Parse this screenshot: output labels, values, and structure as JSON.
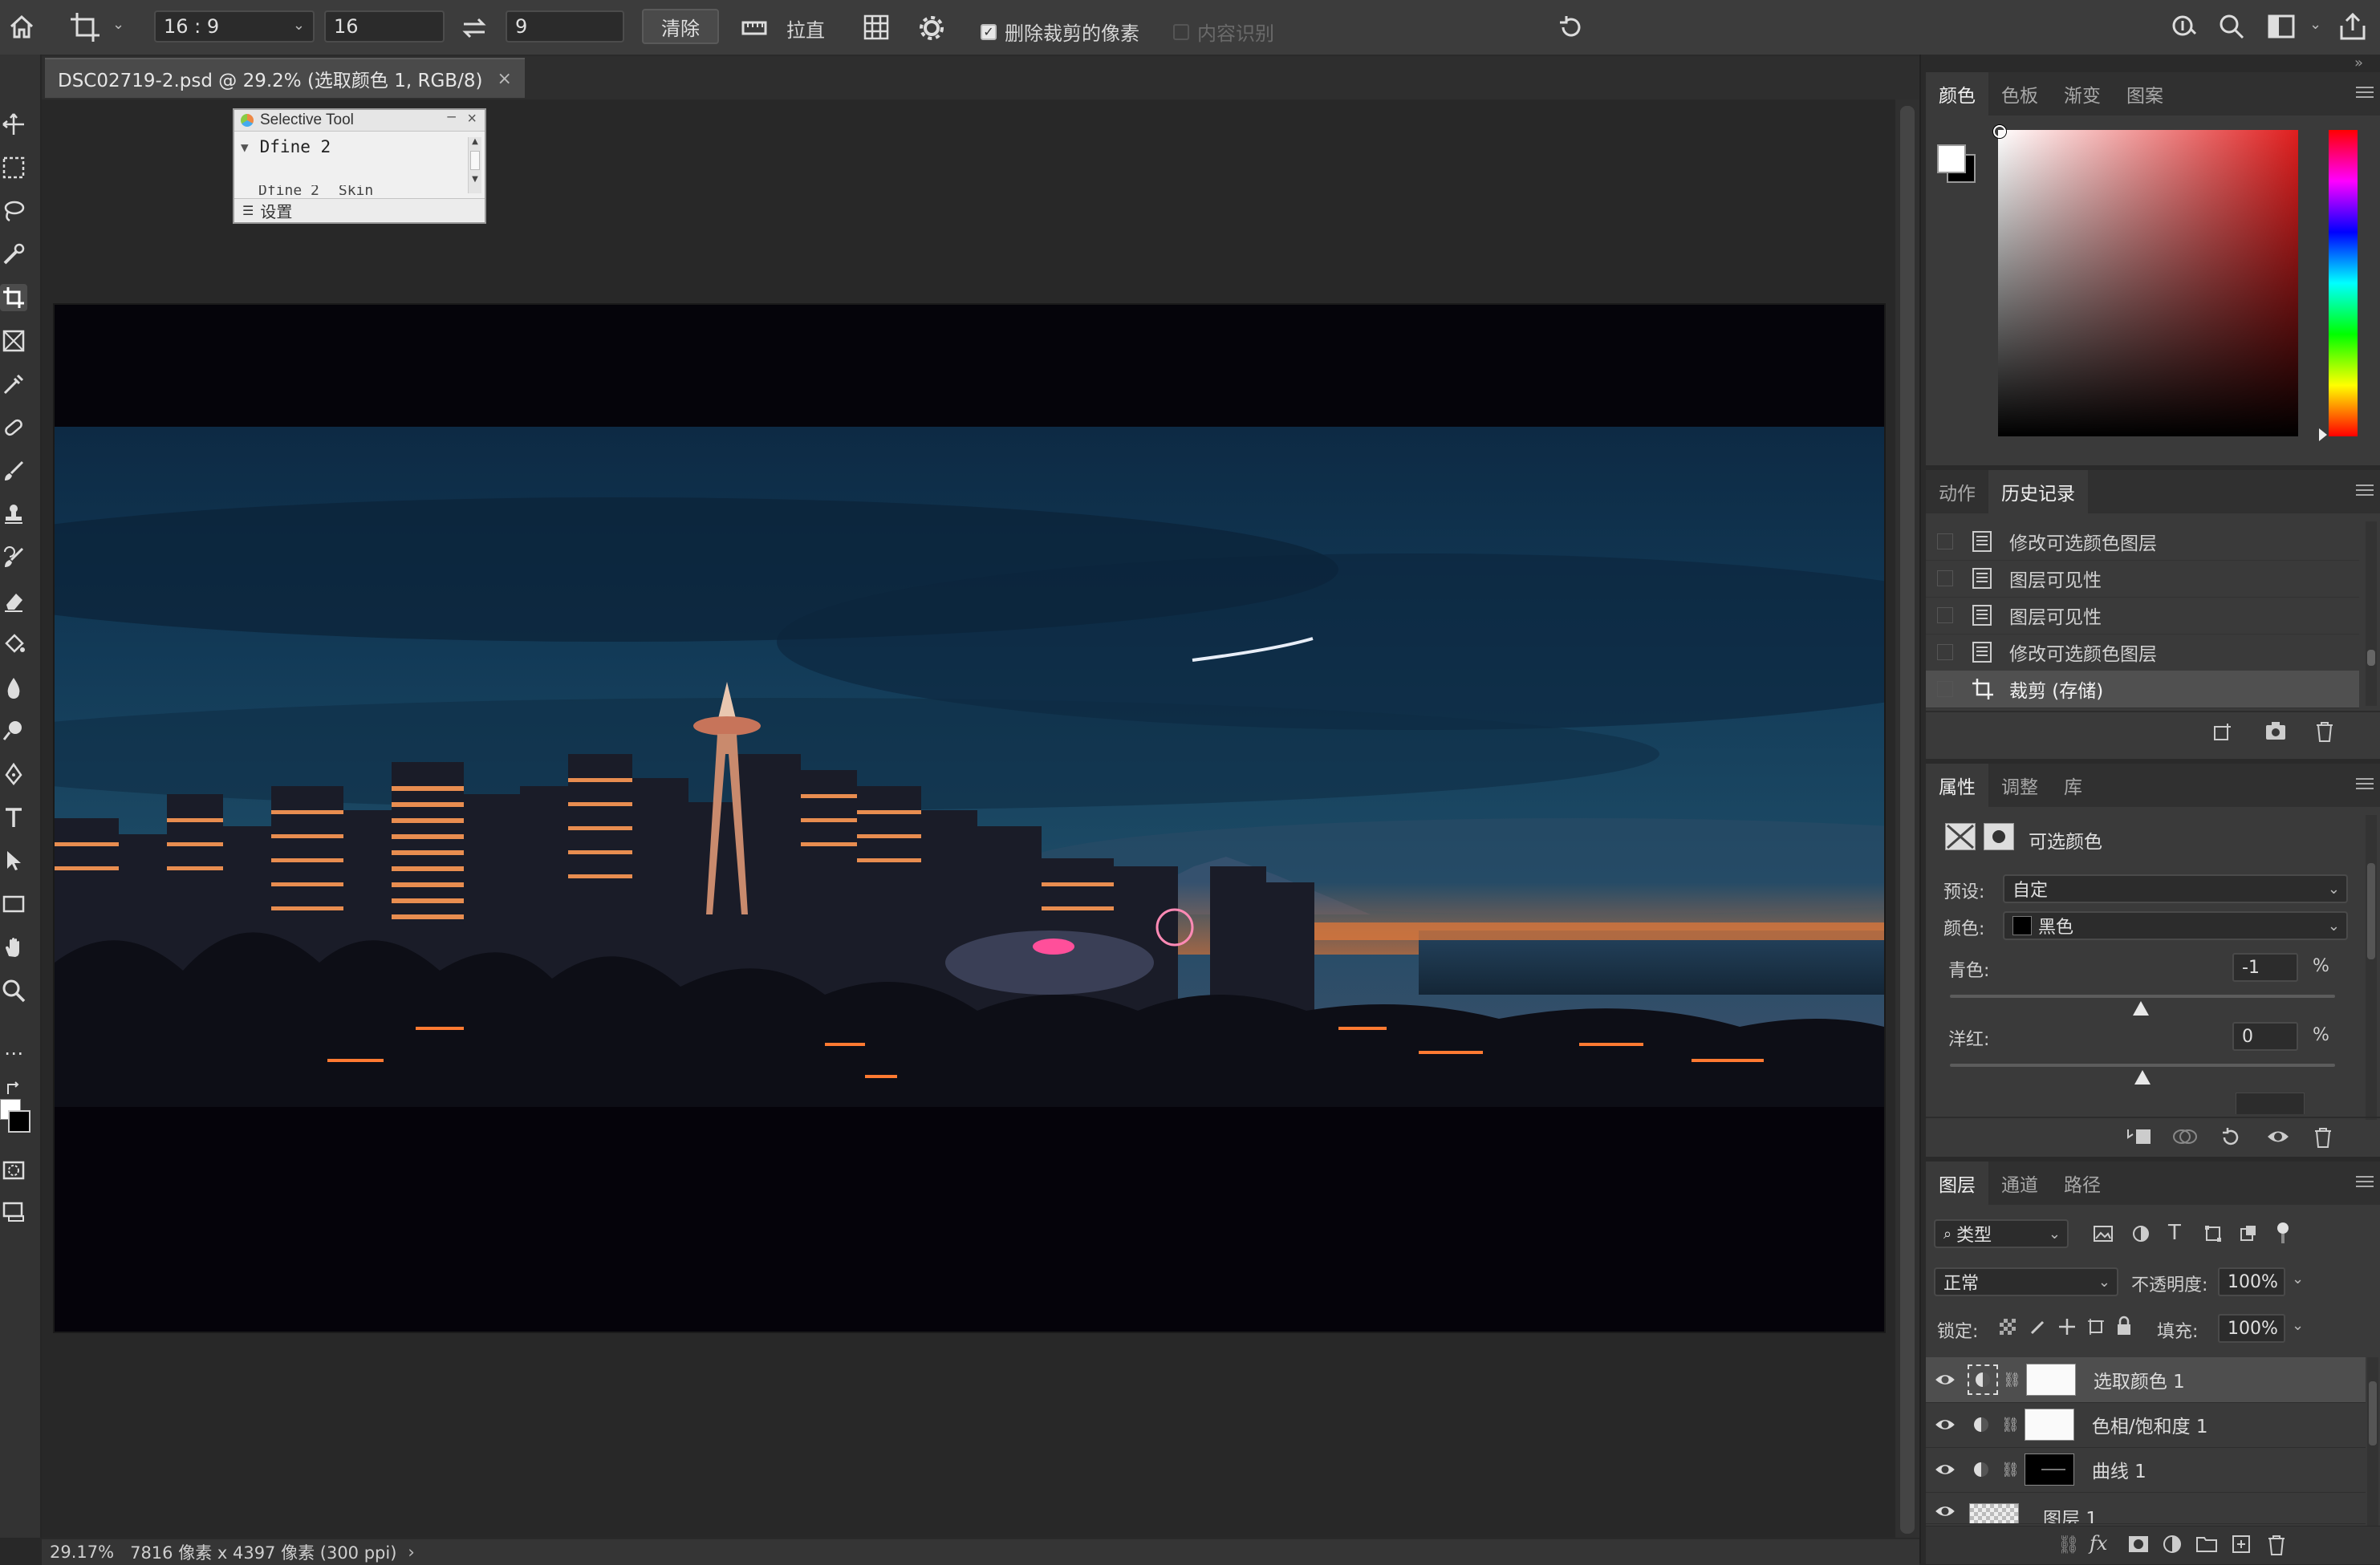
{
  "options_bar": {
    "ratio_preset": "16 : 9",
    "width_value": "16",
    "height_value": "9",
    "clear_label": "清除",
    "straighten_label": "拉直",
    "delete_cropped_label": "删除裁剪的像素",
    "content_aware_label": "内容识别"
  },
  "document": {
    "tab_title": "DSC02719-2.psd @ 29.2% (选取颜色 1, RGB/8)",
    "zoom": "29.17%",
    "dimensions": "7816 像素 x 4397 像素 (300 ppi)"
  },
  "selective_tool": {
    "title": "Selective Tool",
    "item": "Dfine 2",
    "sub1": "Dfine 2",
    "sub2": "Skin",
    "settings": "设置"
  },
  "color_panel": {
    "tabs": [
      "颜色",
      "色板",
      "渐变",
      "图案"
    ],
    "foreground": "#ffffff",
    "background": "#000000",
    "hue_color": "#e01e1e"
  },
  "history_panel": {
    "tabs": [
      "动作",
      "历史记录"
    ],
    "items": [
      "修改可选颜色图层",
      "图层可见性",
      "图层可见性",
      "修改可选颜色图层",
      "裁剪 (存储)"
    ]
  },
  "properties_panel": {
    "tabs": [
      "属性",
      "调整",
      "库"
    ],
    "title": "可选颜色",
    "preset_label": "预设:",
    "preset_value": "自定",
    "colors_label": "颜色:",
    "colors_value": "黑色",
    "cyan_label": "青色:",
    "cyan_value": "-1",
    "magenta_label": "洋红:",
    "magenta_value": "0",
    "percent": "%"
  },
  "layers_panel": {
    "tabs": [
      "图层",
      "通道",
      "路径"
    ],
    "filter_label": "类型",
    "blend_mode": "正常",
    "opacity_label": "不透明度:",
    "opacity_value": "100%",
    "lock_label": "锁定:",
    "fill_label": "填充:",
    "fill_value": "100%",
    "layers": [
      {
        "name": "选取颜色 1"
      },
      {
        "name": "色相/饱和度 1"
      },
      {
        "name": "曲线 1"
      },
      {
        "name": "图层 1"
      }
    ]
  }
}
